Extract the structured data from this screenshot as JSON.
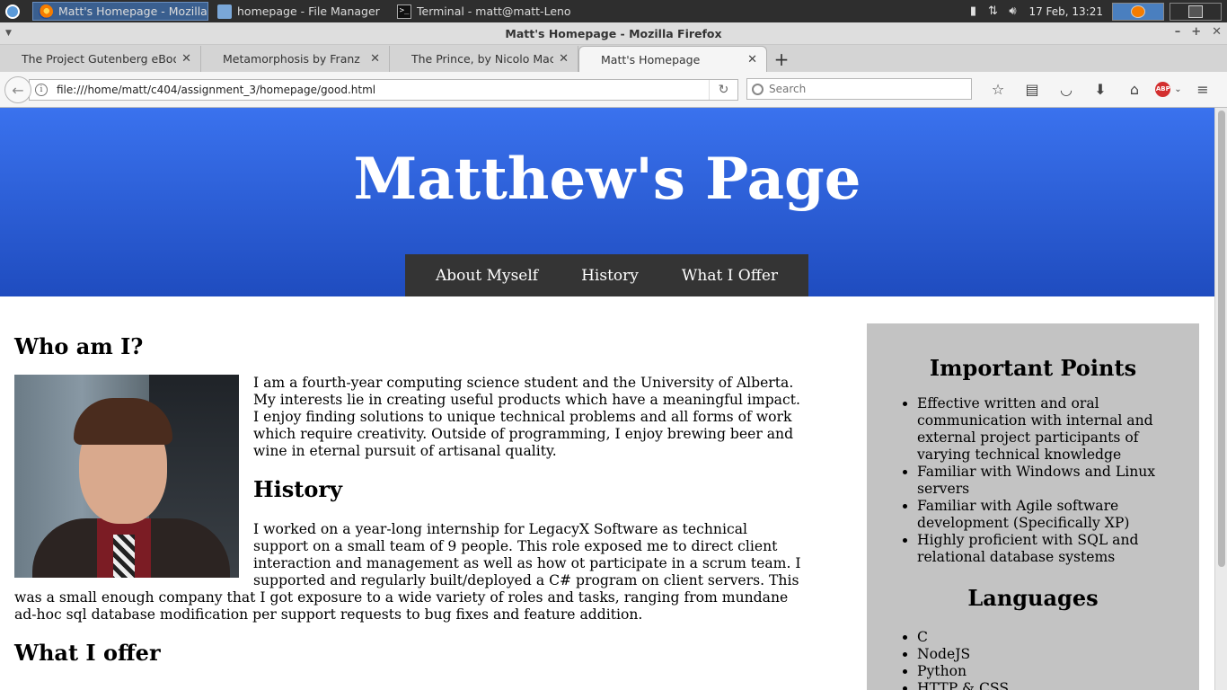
{
  "taskbar": {
    "windows": [
      {
        "label": "Matt's Homepage - Mozilla F...",
        "icon": "firefox-icon"
      },
      {
        "label": "homepage - File Manager",
        "icon": "folder-icon"
      },
      {
        "label": "Terminal - matt@matt-Lenov...",
        "icon": "terminal-icon"
      }
    ],
    "clock": "17 Feb, 13:21"
  },
  "browser": {
    "title": "Matt's Homepage - Mozilla Firefox",
    "tabs": [
      {
        "label": "The Project Gutenberg eBook..."
      },
      {
        "label": "Metamorphosis by Franz Kafka"
      },
      {
        "label": "The Prince, by Nicolo Machia..."
      },
      {
        "label": "Matt's Homepage",
        "selected": true
      }
    ],
    "url": "file:///home/matt/c404/assignment_3/homepage/good.html",
    "search_placeholder": "Search",
    "abp_label": "ABP"
  },
  "page": {
    "heading": "Matthew's Page",
    "nav": [
      "About Myself",
      "History",
      "What I Offer"
    ],
    "who_heading": "Who am I?",
    "who_text": "I am a fourth-year computing science student and the University of Alberta. My interests lie in creating useful products which have a meaningful impact. I enjoy finding solutions to unique technical problems and all forms of work which require creativity. Outside of programming, I enjoy brewing beer and wine in eternal pursuit of artisanal quality.",
    "history_heading": "History",
    "history_text": "I worked on a year-long internship for LegacyX Software as technical support on a small team of 9 people. This role exposed me to direct client interaction and management as well as how ot participate in a scrum team. I supported and regularly built/deployed a C# program on client servers. This was a small enough company that I got exposure to a wide variety of roles and tasks, ranging from mundane ad-hoc sql database modification per support requests to bug fixes and feature addition.",
    "offer_heading": "What I offer",
    "sidebar": {
      "points_heading": "Important Points",
      "points": [
        "Effective written and oral communication with internal and external project participants of varying technical knowledge",
        "Familiar with Windows and Linux servers",
        "Familiar with Agile software development (Specifically XP)",
        "Highly proficient with SQL and relational database systems"
      ],
      "languages_heading": "Languages",
      "languages": [
        "C",
        "NodeJS",
        "Python",
        "HTTP & CSS"
      ]
    }
  },
  "colors": {
    "hero_top": "#3a72ee",
    "hero_bottom": "#1f4cbf",
    "nav_bg": "#343434",
    "sidebar_bg": "#c3c3c3"
  }
}
